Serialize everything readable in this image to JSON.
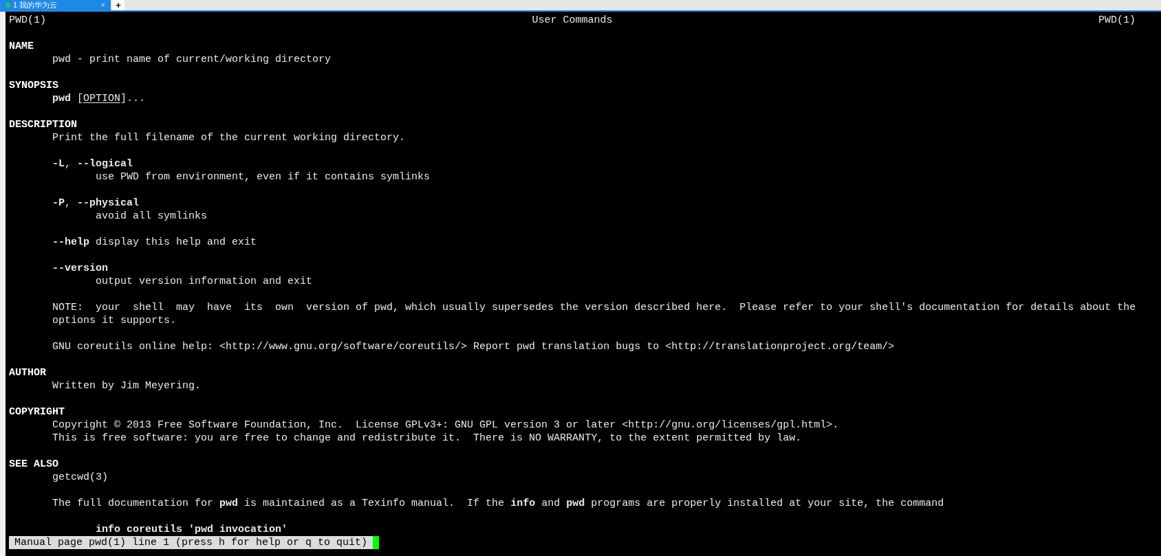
{
  "tab_bar": {
    "tabs": [
      {
        "label": "1 我的华为云",
        "selected": true,
        "close": "×"
      }
    ],
    "new_tab": "+"
  },
  "header": {
    "left": "PWD(1)",
    "center": "User Commands",
    "right": "PWD(1)"
  },
  "sections": [
    {
      "title": "NAME",
      "blocks": [
        {
          "lines": [
            [
              {
                "text": "pwd - print name of current/working directory",
                "kind": "plain"
              }
            ]
          ]
        }
      ]
    },
    {
      "title": "SYNOPSIS",
      "blocks": [
        {
          "lines": [
            [
              {
                "text": "pwd",
                "kind": "bold"
              },
              {
                "text": " [",
                "kind": "plain"
              },
              {
                "text": "OPTION",
                "kind": "underline"
              },
              {
                "text": "]...",
                "kind": "plain"
              }
            ]
          ]
        }
      ]
    },
    {
      "title": "DESCRIPTION",
      "blocks": [
        {
          "lines": [
            [
              {
                "text": "Print the full filename of the current working directory.",
                "kind": "plain"
              }
            ]
          ]
        },
        {
          "lines": [
            [
              {
                "text": "-L",
                "kind": "bold"
              },
              {
                "text": ", ",
                "kind": "plain"
              },
              {
                "text": "--logical",
                "kind": "bold"
              }
            ]
          ],
          "children": [
            {
              "lines": [
                [
                  {
                    "text": "use PWD from environment, even if it contains symlinks",
                    "kind": "plain"
                  }
                ]
              ]
            }
          ]
        },
        {
          "lines": [
            [
              {
                "text": "-P",
                "kind": "bold"
              },
              {
                "text": ", ",
                "kind": "plain"
              },
              {
                "text": "--physical",
                "kind": "bold"
              }
            ]
          ],
          "children": [
            {
              "lines": [
                [
                  {
                    "text": "avoid all symlinks",
                    "kind": "plain"
                  }
                ]
              ]
            }
          ]
        },
        {
          "lines": [
            [
              {
                "text": "--help",
                "kind": "bold"
              },
              {
                "text": " display this help and exit",
                "kind": "plain"
              }
            ]
          ]
        },
        {
          "lines": [
            [
              {
                "text": "--version",
                "kind": "bold"
              }
            ]
          ],
          "children": [
            {
              "lines": [
                [
                  {
                    "text": "output version information and exit",
                    "kind": "plain"
                  }
                ]
              ]
            }
          ]
        },
        {
          "lines": [
            [
              {
                "text": "NOTE:  your  shell  may  have  its  own  version of pwd, which usually supersedes the version described here.  Please refer to your shell's documentation for details about the",
                "kind": "plain"
              }
            ],
            [
              {
                "text": "options it supports.",
                "kind": "plain"
              }
            ]
          ]
        },
        {
          "lines": [
            [
              {
                "text": "GNU coreutils online help: <http://www.gnu.org/software/coreutils/> Report pwd translation bugs to <http://translationproject.org/team/>",
                "kind": "plain"
              }
            ]
          ]
        }
      ]
    },
    {
      "title": "AUTHOR",
      "blocks": [
        {
          "lines": [
            [
              {
                "text": "Written by Jim Meyering.",
                "kind": "plain"
              }
            ]
          ]
        }
      ]
    },
    {
      "title": "COPYRIGHT",
      "blocks": [
        {
          "lines": [
            [
              {
                "text": "Copyright © 2013 Free Software Foundation, Inc.  License GPLv3+: GNU GPL version 3 or later <http://gnu.org/licenses/gpl.html>.",
                "kind": "plain"
              }
            ],
            [
              {
                "text": "This is free software: you are free to change and redistribute it.  There is NO WARRANTY, to the extent permitted by law.",
                "kind": "plain"
              }
            ]
          ]
        }
      ]
    },
    {
      "title": "SEE ALSO",
      "blocks": [
        {
          "lines": [
            [
              {
                "text": "getcwd(3)",
                "kind": "plain"
              }
            ]
          ]
        },
        {
          "lines": [
            [
              {
                "text": "The full documentation for ",
                "kind": "plain"
              },
              {
                "text": "pwd",
                "kind": "bold"
              },
              {
                "text": " is maintained as a Texinfo manual.  If the ",
                "kind": "plain"
              },
              {
                "text": "info",
                "kind": "bold"
              },
              {
                "text": " and ",
                "kind": "plain"
              },
              {
                "text": "pwd",
                "kind": "bold"
              },
              {
                "text": " programs are properly installed at your site, the command",
                "kind": "plain"
              }
            ]
          ]
        },
        {
          "children": [
            {
              "lines": [
                [
                  {
                    "text": "info coreutils 'pwd invocation'",
                    "kind": "bold"
                  }
                ]
              ]
            }
          ]
        }
      ]
    }
  ],
  "status_line": {
    "text": "Manual page pwd(1) line 1 (press h for help or q to quit)"
  }
}
